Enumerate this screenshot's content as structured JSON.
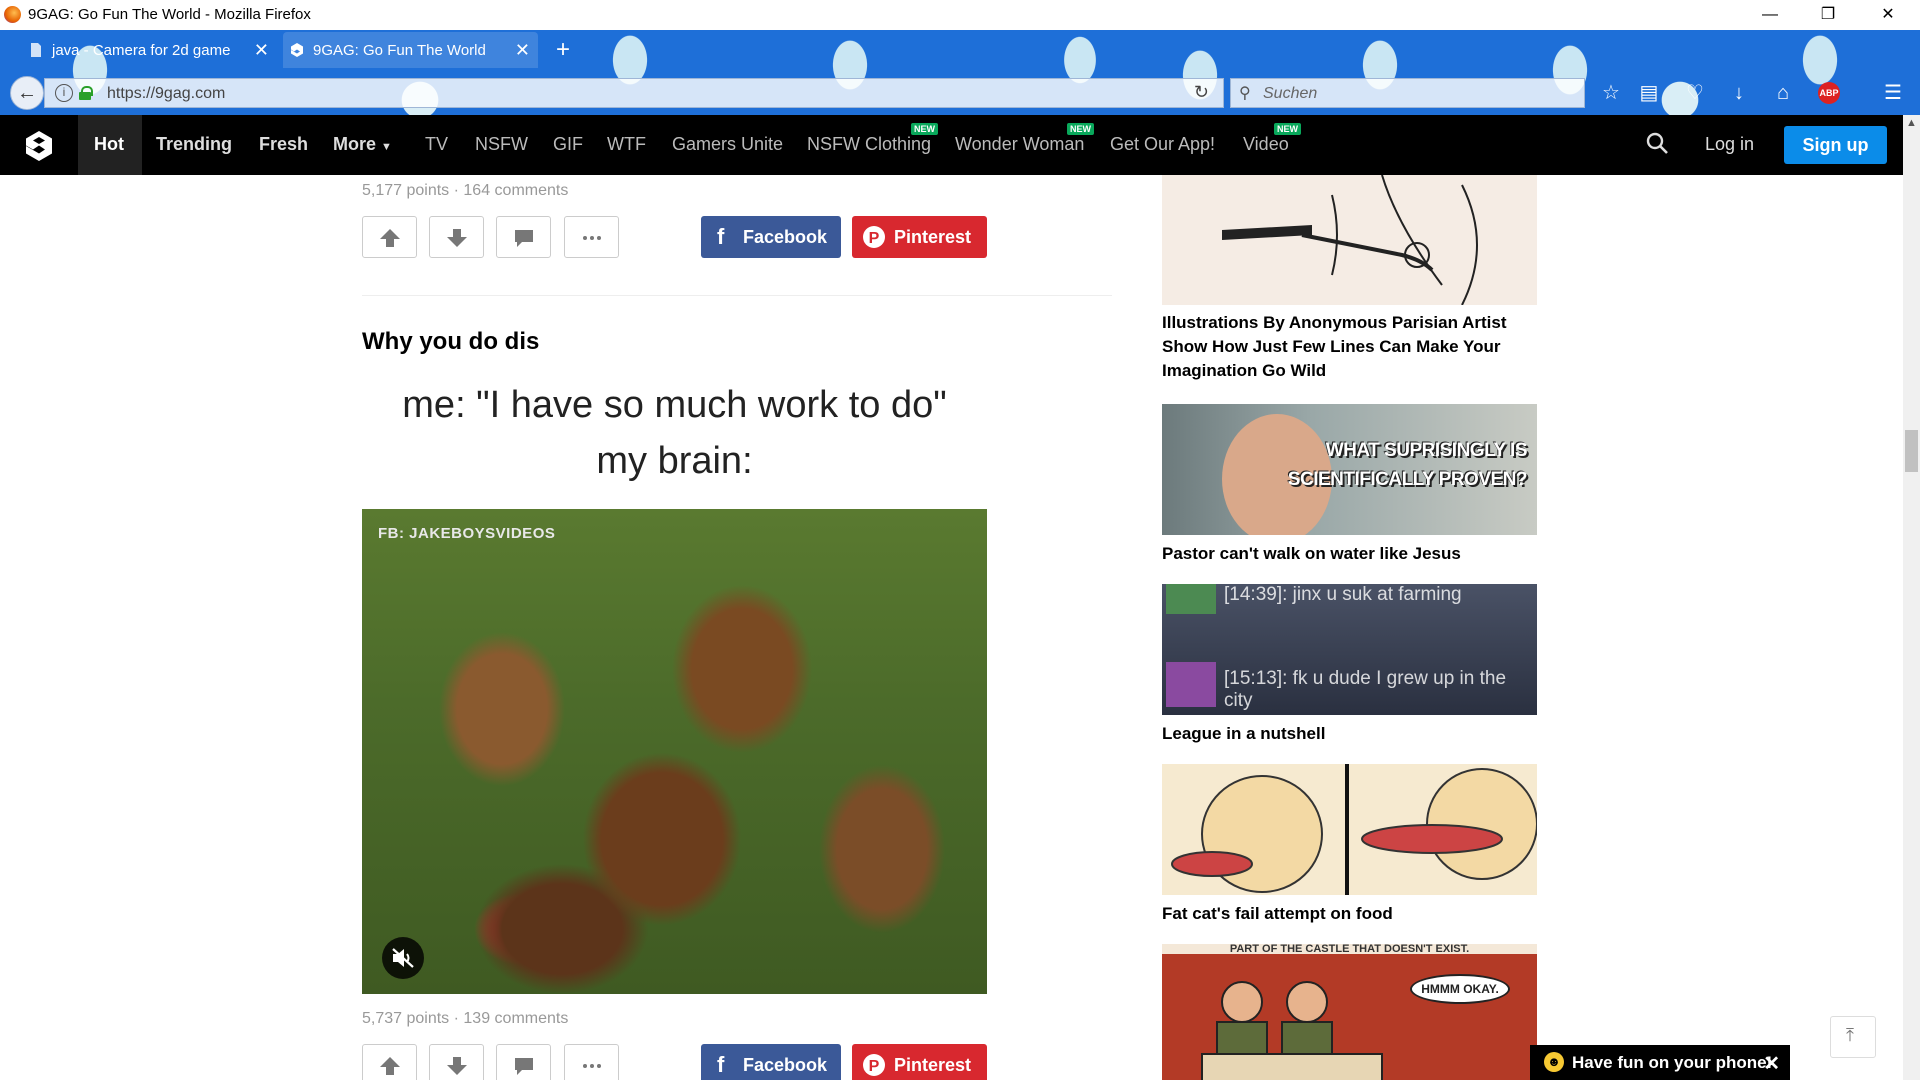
{
  "window": {
    "title": "9GAG: Go Fun The World - Mozilla Firefox"
  },
  "tabs": [
    {
      "label": "java - Camera for 2d game"
    },
    {
      "label": "9GAG: Go Fun The World"
    }
  ],
  "urlbar": {
    "url": "https://9gag.com"
  },
  "searchbar": {
    "placeholder": "Suchen"
  },
  "site_nav": {
    "hot": "Hot",
    "trending": "Trending",
    "fresh": "Fresh",
    "more": "More",
    "items": [
      "TV",
      "NSFW",
      "GIF",
      "WTF",
      "Gamers Unite",
      "NSFW Clothing",
      "Wonder Woman",
      "Get Our App!",
      "Video"
    ],
    "new_badge": "NEW",
    "login": "Log in",
    "signup": "Sign up"
  },
  "posts": [
    {
      "meta": "5,177 points · 164 comments"
    },
    {
      "title": "Why you do dis",
      "meme_line1": "me: \"I have so much work to do\"",
      "meme_line2": "my brain:",
      "watermark": "FB: JAKEBOYSVIDEOS",
      "meta": "5,737 points · 139 comments"
    }
  ],
  "share": {
    "facebook": "Facebook",
    "pinterest": "Pinterest"
  },
  "sidebar": [
    {
      "caption": "Illustrations By Anonymous Parisian Artist Show How Just Few Lines Can Make Your Imagination Go Wild"
    },
    {
      "caption": "Pastor can't walk on water like Jesus",
      "overlay1": "WHAT SUPRISINGLY IS",
      "overlay2": "SCIENTIFICALLY PROVEN?"
    },
    {
      "caption": "League in a nutshell",
      "chat1": "[14:39]: jinx u suk at farming",
      "chat2": "[15:13]: fk u dude I grew up in the city"
    },
    {
      "caption": "Fat cat's fail attempt on food"
    },
    {
      "strip": "PART OF THE CASTLE THAT DOESN'T EXIST.",
      "bubble": "HMMM OKAY."
    }
  ],
  "app_banner": {
    "text": "Have fun on your phone!"
  }
}
